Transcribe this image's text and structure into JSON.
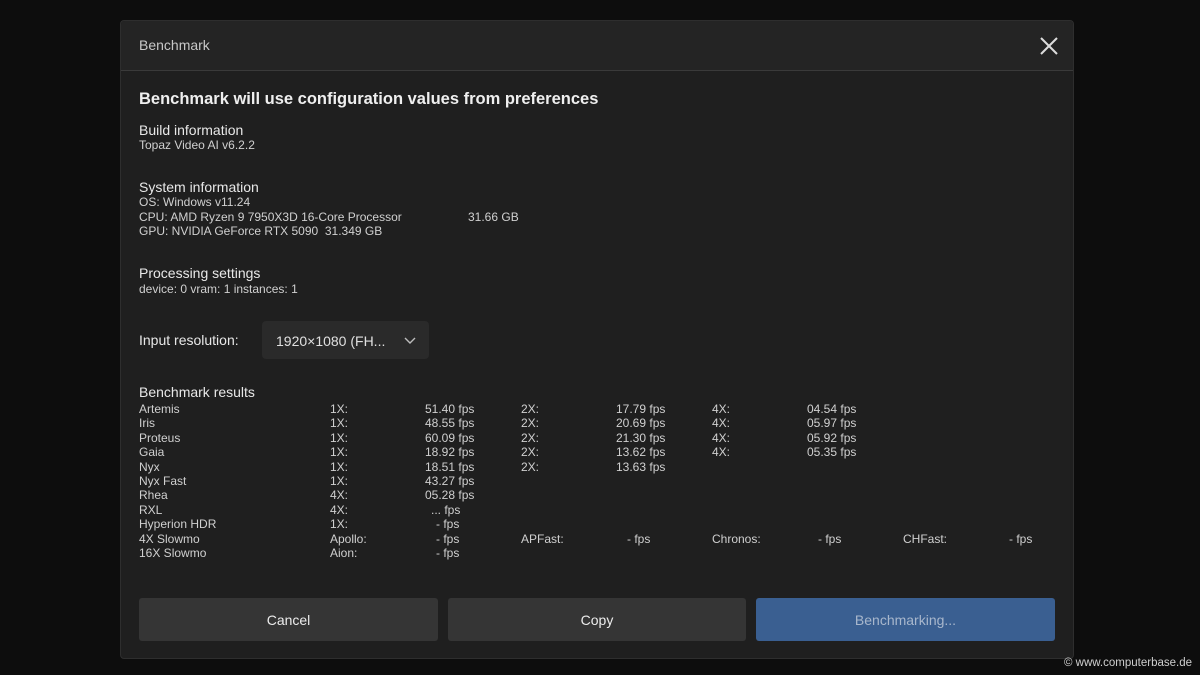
{
  "dialog": {
    "title": "Benchmark",
    "heading": "Benchmark will use configuration values from preferences"
  },
  "build": {
    "title": "Build information",
    "version": "Topaz Video AI v6.2.2"
  },
  "system": {
    "title": "System information",
    "os": "OS: Windows v11.24",
    "cpu": "CPU: AMD Ryzen 9 7950X3D 16-Core Processor",
    "ram": "31.66 GB",
    "gpu": "GPU: NVIDIA GeForce RTX 5090  31.349 GB"
  },
  "processing": {
    "title": "Processing settings",
    "line": "device: 0 vram: 1 instances: 1"
  },
  "input": {
    "label": "Input resolution:",
    "value": "1920×1080 (FH..."
  },
  "results": {
    "title": "Benchmark results",
    "rows": [
      {
        "model": "Artemis",
        "c1": "1X:",
        "v1": "51.40 fps",
        "c2": "2X:",
        "v2": "17.79 fps",
        "c3": "4X:",
        "v3": "04.54 fps",
        "c4": "",
        "v4": ""
      },
      {
        "model": "Iris",
        "c1": "1X:",
        "v1": "48.55 fps",
        "c2": "2X:",
        "v2": "20.69 fps",
        "c3": "4X:",
        "v3": "05.97 fps",
        "c4": "",
        "v4": ""
      },
      {
        "model": "Proteus",
        "c1": "1X:",
        "v1": "60.09 fps",
        "c2": "2X:",
        "v2": "21.30 fps",
        "c3": "4X:",
        "v3": "05.92 fps",
        "c4": "",
        "v4": ""
      },
      {
        "model": "Gaia",
        "c1": "1X:",
        "v1": "18.92 fps",
        "c2": "2X:",
        "v2": "13.62 fps",
        "c3": "4X:",
        "v3": "05.35 fps",
        "c4": "",
        "v4": ""
      },
      {
        "model": "Nyx",
        "c1": "1X:",
        "v1": "18.51 fps",
        "c2": "2X:",
        "v2": "13.63 fps",
        "c3": "",
        "v3": "",
        "c4": "",
        "v4": ""
      },
      {
        "model": "Nyx Fast",
        "c1": "1X:",
        "v1": "43.27 fps",
        "c2": "",
        "v2": "",
        "c3": "",
        "v3": "",
        "c4": "",
        "v4": ""
      },
      {
        "model": "Rhea",
        "c1": "4X:",
        "v1": "05.28 fps",
        "c2": "",
        "v2": "",
        "c3": "",
        "v3": "",
        "c4": "",
        "v4": ""
      },
      {
        "model": "RXL",
        "c1": "4X:",
        "v1": "...   fps",
        "c2": "",
        "v2": "",
        "c3": "",
        "v3": "",
        "c4": "",
        "v4": ""
      },
      {
        "model": "Hyperion HDR",
        "c1": "1X:",
        "v1": "-     fps",
        "c2": "",
        "v2": "",
        "c3": "",
        "v3": "",
        "c4": "",
        "v4": ""
      },
      {
        "model": "4X Slowmo",
        "c1": "Apollo:",
        "v1": "-     fps",
        "c2": "APFast:",
        "v2": "-     fps",
        "c3": "Chronos:",
        "v3": "-     fps",
        "c4": "CHFast:",
        "v4": "-     fps"
      },
      {
        "model": "16X Slowmo",
        "c1": "Aion:",
        "v1": "-     fps",
        "c2": "",
        "v2": "",
        "c3": "",
        "v3": "",
        "c4": "",
        "v4": ""
      }
    ]
  },
  "buttons": {
    "cancel": "Cancel",
    "copy": "Copy",
    "benchmarking": "Benchmarking..."
  },
  "watermark": "© www.computerbase.de",
  "icons": {
    "close": "close-icon",
    "dropdown": "chevron-down-icon"
  },
  "colors": {
    "primary_button": "#3a5f91"
  }
}
